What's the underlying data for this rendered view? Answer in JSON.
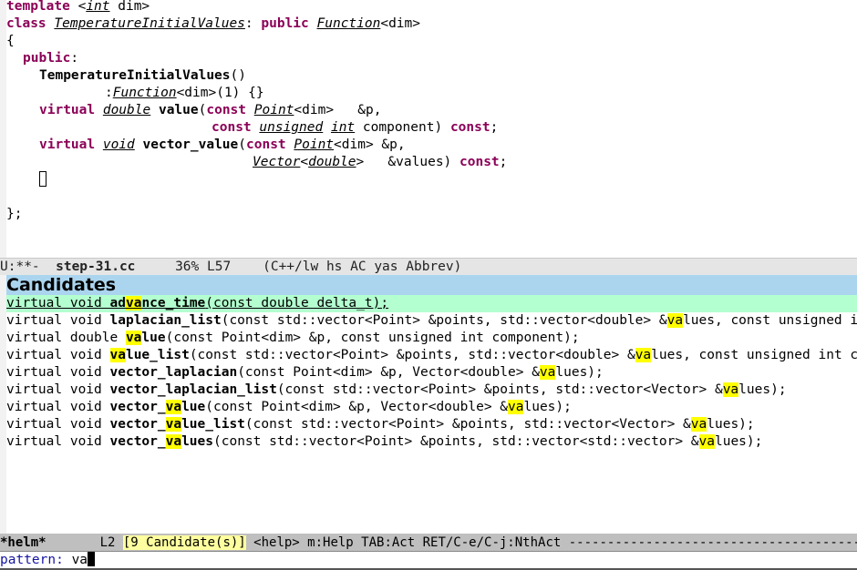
{
  "editor": {
    "lines": {
      "l1": {
        "kw": "template",
        "lt": " <",
        "type": "int",
        "rest": " dim>"
      },
      "l2": {
        "kw": "class",
        "sp": " ",
        "type": "TemperatureInitialValues",
        "colon": ": ",
        "kw2": "public",
        "sp2": " ",
        "type2": "Function",
        "rest": "<dim>"
      },
      "l3": {
        "text": "{"
      },
      "l4": {
        "kw": "public",
        "rest": ":"
      },
      "l5": {
        "fn": "TemperatureInitialValues",
        "rest": "()"
      },
      "l6": {
        "pre": ":",
        "type": "Function",
        "rest": "<dim>(1) {}"
      },
      "l7": {
        "kw": "virtual",
        "type": "double",
        "fn": "value",
        "p1": "(",
        "kw2": "const",
        "type2": "Point",
        "rest": "<dim>   &p,"
      },
      "l8": {
        "kw": "const",
        "type": "unsigned",
        "type2": "int",
        "rest": " component) ",
        "kw2": "const",
        "end": ";"
      },
      "l9": {
        "kw": "virtual",
        "type": "void",
        "fn": "vector_value",
        "p1": "(",
        "kw2": "const",
        "type2": "Point",
        "rest": "<dim> &p,"
      },
      "l10": {
        "type": "Vector",
        "lt": "<",
        "type2": "double",
        "rest": ">   &values) ",
        "kw": "const",
        "end": ";"
      },
      "l11": {
        "text": "};"
      }
    }
  },
  "modeline": {
    "status": "U:**-  ",
    "buffer": "step-31.cc",
    "position": "     36% L57    ",
    "modes": "(C++/lw hs AC yas Abbrev)"
  },
  "helm": {
    "header": "Candidates",
    "candidates": [
      {
        "pre": "virtual void ",
        "b1": "ad",
        "hlb": "va",
        "b2": "nce_time",
        "post1": "(const double delta_t);",
        "hl2": "",
        "post2": "",
        "selected": true
      },
      {
        "pre": "virtual void ",
        "b1": "laplacian_list",
        "hlb": "",
        "b2": "",
        "post1": "(const std::vector<Point> &points, std::vector<double> &",
        "hl2": "va",
        "post2": "lues, const unsigned int component);"
      },
      {
        "pre": "virtual double ",
        "b1": "",
        "hlb": "va",
        "b2": "lue",
        "post1": "(const Point<dim> &p, const unsigned int component);",
        "hl2": "",
        "post2": ""
      },
      {
        "pre": "virtual void ",
        "b1": "",
        "hlb": "va",
        "b2": "lue_list",
        "post1": "(const std::vector<Point> &points, std::vector<double> &",
        "hl2": "va",
        "post2": "lues, const unsigned int component);"
      },
      {
        "pre": "virtual void ",
        "b1": "vector_laplacian",
        "hlb": "",
        "b2": "",
        "post1": "(const Point<dim> &p, Vector<double> &",
        "hl2": "va",
        "post2": "lues);"
      },
      {
        "pre": "virtual void ",
        "b1": "vector_laplacian_list",
        "hlb": "",
        "b2": "",
        "post1": "(const std::vector<Point> &points, std::vector<Vector> &",
        "hl2": "va",
        "post2": "lues);"
      },
      {
        "pre": "virtual void ",
        "b1": "vector_",
        "hlb": "va",
        "b2": "lue",
        "post1": "(const Point<dim> &p, Vector<double> &",
        "hl2": "va",
        "post2": "lues);"
      },
      {
        "pre": "virtual void ",
        "b1": "vector_",
        "hlb": "va",
        "b2": "lue_list",
        "post1": "(const std::vector<Point> &points, std::vector<Vector> &",
        "hl2": "va",
        "post2": "lues);"
      },
      {
        "pre": "virtual void ",
        "b1": "vector_",
        "hlb": "va",
        "b2": "lues",
        "post1": "(const std::vector<Point> &points, std::vector<std::vector> &",
        "hl2": "va",
        "post2": "lues);"
      }
    ],
    "modeline": {
      "name": "*helm*",
      "gap": "       L2 ",
      "count": "[9 Candidate(s)]",
      "help": " <help> m:Help TAB:Act RET/C-e/C-j:NthAct ----------------------------------------------------------"
    }
  },
  "minibuffer": {
    "prompt": "pattern: ",
    "value": "va"
  },
  "colors": {
    "keyword": "#8b0057",
    "header_bg": "#abd5ef",
    "selection_bg": "#b3ffcf",
    "match_highlight": "#ffff00",
    "count_bg": "#ffffa0",
    "prompt": "#1515a0"
  }
}
